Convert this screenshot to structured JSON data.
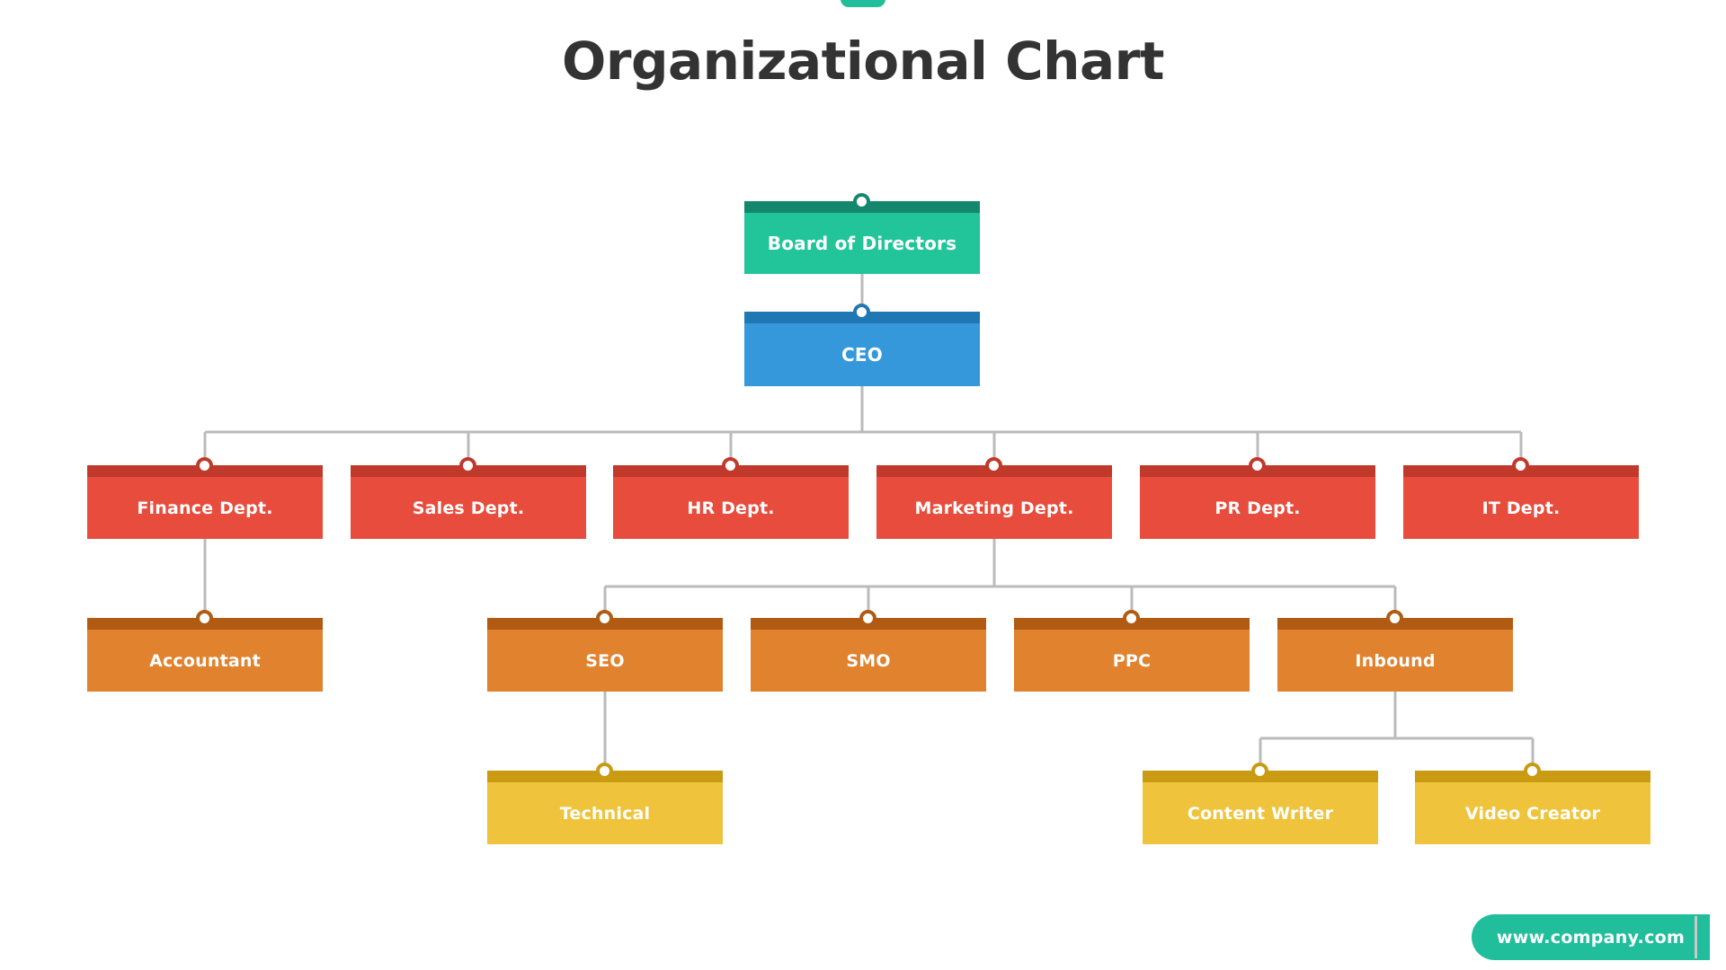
{
  "page": {
    "title": "Organizational Chart",
    "background": "#ffffff",
    "title_color": "#333333"
  },
  "accent": {
    "top_tab_color": "#21BE9B",
    "connector_color": "#BBBBBB"
  },
  "palette": {
    "teal_body": "#22C49A",
    "teal_bar": "#15876D",
    "blue_body": "#3498DB",
    "blue_bar": "#1F77B4",
    "red_body": "#E74C3C",
    "red_bar": "#C0392B",
    "orange_body": "#E0822E",
    "orange_bar": "#B05A12",
    "yellow_body": "#EFC43C",
    "yellow_bar": "#C99A12"
  },
  "chart_data": {
    "type": "diagram",
    "title": "Organizational Chart",
    "levels": [
      {
        "level": 1,
        "name": "executive-board",
        "color": "teal"
      },
      {
        "level": 2,
        "name": "executive-officer",
        "color": "blue"
      },
      {
        "level": 3,
        "name": "departments",
        "color": "red"
      },
      {
        "level": 4,
        "name": "teams",
        "color": "orange"
      },
      {
        "level": 5,
        "name": "roles",
        "color": "yellow"
      }
    ],
    "nodes": [
      {
        "id": "board",
        "label": "Board of Directors",
        "level": 1,
        "parent": null
      },
      {
        "id": "ceo",
        "label": "CEO",
        "level": 2,
        "parent": "board"
      },
      {
        "id": "finance",
        "label": "Finance Dept.",
        "level": 3,
        "parent": "ceo"
      },
      {
        "id": "sales",
        "label": "Sales Dept.",
        "level": 3,
        "parent": "ceo"
      },
      {
        "id": "hr",
        "label": "HR Dept.",
        "level": 3,
        "parent": "ceo"
      },
      {
        "id": "marketing",
        "label": "Marketing Dept.",
        "level": 3,
        "parent": "ceo"
      },
      {
        "id": "pr",
        "label": "PR Dept.",
        "level": 3,
        "parent": "ceo"
      },
      {
        "id": "it",
        "label": "IT Dept.",
        "level": 3,
        "parent": "ceo"
      },
      {
        "id": "accountant",
        "label": "Accountant",
        "level": 4,
        "parent": "finance"
      },
      {
        "id": "seo",
        "label": "SEO",
        "level": 4,
        "parent": "marketing"
      },
      {
        "id": "smo",
        "label": "SMO",
        "level": 4,
        "parent": "marketing"
      },
      {
        "id": "ppc",
        "label": "PPC",
        "level": 4,
        "parent": "marketing"
      },
      {
        "id": "inbound",
        "label": "Inbound",
        "level": 4,
        "parent": "marketing"
      },
      {
        "id": "technical",
        "label": "Technical",
        "level": 5,
        "parent": "seo"
      },
      {
        "id": "contentwriter",
        "label": "Content Writer",
        "level": 5,
        "parent": "inbound"
      },
      {
        "id": "videocreator",
        "label": "Video Creator",
        "level": 5,
        "parent": "inbound"
      }
    ]
  },
  "footer": {
    "website": "www.company.com"
  }
}
